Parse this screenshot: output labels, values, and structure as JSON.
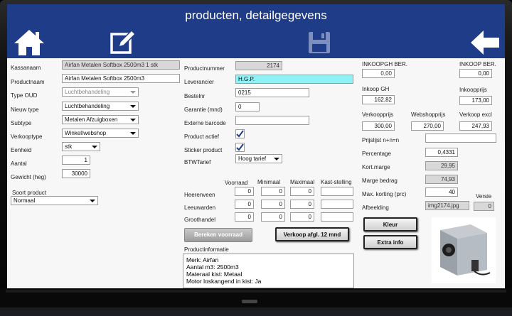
{
  "app": {
    "title": "producten, detailgegevens"
  },
  "left": {
    "kassanaam": {
      "label": "Kassanaam",
      "value": "Airfan Metalen Softbox 2500m3 1 stk"
    },
    "productnaam": {
      "label": "Productnaam",
      "value": "Airfan Metalen Softbox 2500m3"
    },
    "type_oud": {
      "label": "Type OUD",
      "value": "Luchtbehandeling"
    },
    "nieuw_type": {
      "label": "Nieuw type",
      "value": "Luchtbehandeling"
    },
    "subtype": {
      "label": "Subtype",
      "value": "Metalen Afzuigboxen"
    },
    "verkooptype": {
      "label": "Verkooptype",
      "value": "Winkel/webshop"
    },
    "eenheid": {
      "label": "Eenheid",
      "value": "stk"
    },
    "aantal": {
      "label": "Aantal",
      "value": "1"
    },
    "gewicht": {
      "label": "Gewicht (heg)",
      "value": "30000"
    },
    "soort": {
      "label": "Soort product",
      "value": "Normaal"
    }
  },
  "mid": {
    "productnummer": {
      "label": "Productnummer",
      "value": "2174"
    },
    "leverancier": {
      "label": "Leverancier",
      "value": "H.G.P."
    },
    "bestelnr": {
      "label": "Bestelnr",
      "value": "0215"
    },
    "garantie": {
      "label": "Garantie (mnd)",
      "value": "0"
    },
    "barcode": {
      "label": "Externe barcode",
      "value": ""
    },
    "product_actief": {
      "label": "Product actief",
      "checked": true
    },
    "sticker_product": {
      "label": "Sticker product",
      "checked": true
    },
    "btw": {
      "label": "BTWTarief",
      "value": "Hoog tarief"
    },
    "stock": {
      "headers": [
        "Voorraad",
        "Minimaal",
        "Maximaal",
        "Kast-stelling"
      ],
      "rows": [
        {
          "name": "Heerenveen",
          "values": [
            "0",
            "0",
            "0",
            ""
          ]
        },
        {
          "name": "Leeuwarden",
          "values": [
            "0",
            "0",
            "0",
            ""
          ]
        },
        {
          "name": "Groothandel",
          "values": [
            "0",
            "0",
            "0",
            ""
          ]
        }
      ]
    },
    "btn_voorraad": "Bereken voorraad",
    "btn_verkoop": "Verkoop afgl. 12 mnd",
    "productinfo_label": "Productinformatie",
    "productinfo_lines": [
      "Merk: Airfan",
      "Aantal m3: 2500m3",
      "Materaal kist: Metaal",
      "Motor loskangend in kist: Ja"
    ]
  },
  "right": {
    "inkoop_gh_ber": {
      "label": "INKOOPGH BER.",
      "value": "0,00"
    },
    "inkoop_ber": {
      "label": "INKOOP BER.",
      "value": "0,00"
    },
    "inkoop_gh": {
      "label": "Inkoop GH",
      "value": "162,82"
    },
    "inkoopprijs": {
      "label": "Inkoopprijs",
      "value": "173,00"
    },
    "verkoopprijs": {
      "label": "Verkoopprijs",
      "value": "300,00"
    },
    "webshopprijs": {
      "label": "Webshopprijs",
      "value": "270,00"
    },
    "verkoop_excl": {
      "label": "Verkoop excl",
      "value": "247,93"
    },
    "prijslijst": {
      "label": "Prijslijst n+n=n",
      "value": ""
    },
    "percentage": {
      "label": "Percentage",
      "value": "0,4331"
    },
    "kortmarge": {
      "label": "Kort.marge",
      "value": "29,95"
    },
    "margebedrag": {
      "label": "Marge bedrag",
      "value": "74,93"
    },
    "maxkorting": {
      "label": "Max. korting (prc)",
      "value": "40"
    },
    "versie": {
      "label": "Versie",
      "value": "0"
    },
    "afbeelding": {
      "label": "Afbeelding",
      "value": "img2174.jpg"
    },
    "btn_kleur": "Kleur",
    "btn_extra": "Extra info"
  },
  "colors": {
    "header": "#1f3c88",
    "leverancier_bg": "#8ff0f5"
  },
  "icons": [
    "home-icon",
    "edit-icon",
    "save-icon",
    "back-arrow-icon"
  ]
}
